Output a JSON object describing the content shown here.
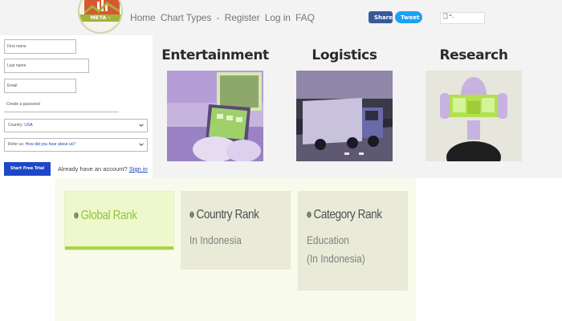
{
  "logo": {
    "text": "META -"
  },
  "nav": {
    "items": [
      "Home",
      "Chart Types",
      "-",
      "Register",
      "Log in",
      "FAQ"
    ]
  },
  "share": {
    "facebook": "Share",
    "twitter": "Tweet"
  },
  "form": {
    "first_name_placeholder": "First name",
    "last_name_placeholder": "Last name",
    "email_placeholder": "Email",
    "password_placeholder": "Create a password",
    "country_label": "Country:",
    "country_value": "USA",
    "referral_label": "Refer us:",
    "referral_value": "How did you hear about us?",
    "cta_label": "Start Free Trial",
    "account_text": "Already have an account?",
    "signin_label": "Sign in"
  },
  "industries": [
    {
      "title": "Entertainment",
      "image": "person-using-tablet"
    },
    {
      "title": "Logistics",
      "image": "truck-on-road"
    },
    {
      "title": "Research",
      "image": "person-holding-glasses"
    }
  ],
  "ranks": [
    {
      "title": "Global Rank",
      "sub1": "",
      "sub2": "",
      "active": true
    },
    {
      "title": "Country Rank",
      "sub1": "In Indonesia",
      "sub2": "",
      "active": false
    },
    {
      "title": "Category Rank",
      "sub1": "Education",
      "sub2": "(In Indonesia)",
      "active": false
    }
  ],
  "colors": {
    "accent_green": "#a7d44a",
    "cta_blue": "#1e47c8",
    "facebook": "#3b5998",
    "twitter": "#1da1f2"
  }
}
